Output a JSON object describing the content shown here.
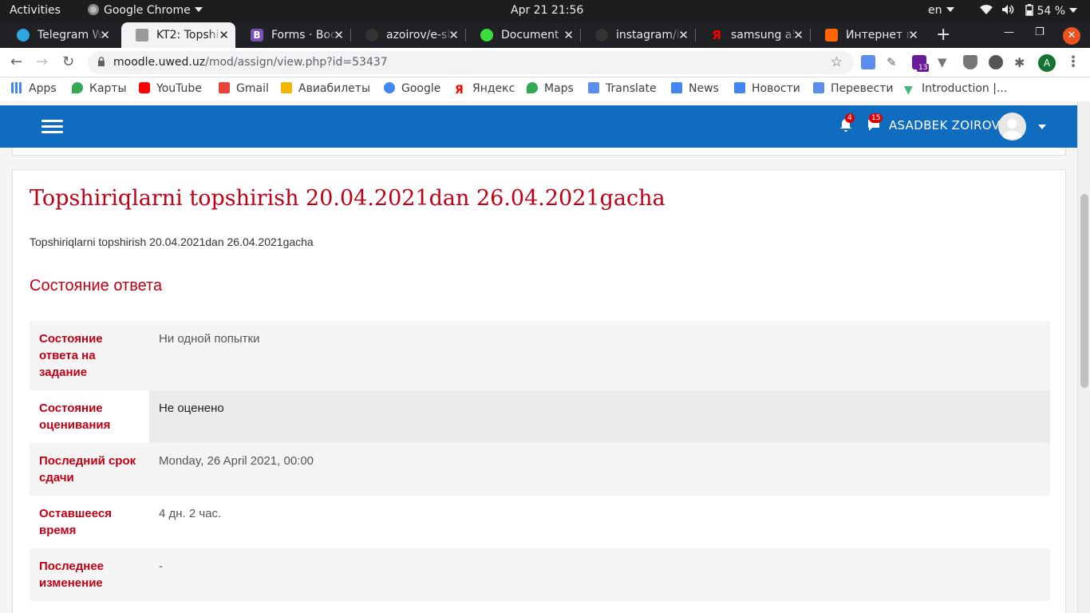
{
  "system": {
    "activities": "Activities",
    "app_name": "Google Chrome",
    "clock": "Apr 21  21:56",
    "lang": "en",
    "battery": "54 %"
  },
  "tabs": [
    {
      "label": "Telegram W",
      "active": false
    },
    {
      "label": "KT2: Topshi",
      "active": true
    },
    {
      "label": "Forms · Boo",
      "active": false
    },
    {
      "label": "azoirov/e-sl",
      "active": false
    },
    {
      "label": "Document",
      "active": false
    },
    {
      "label": "instagram/i",
      "active": false
    },
    {
      "label": "samsung a5",
      "active": false
    },
    {
      "label": "Интернет м",
      "active": false
    }
  ],
  "toolbar": {
    "url_host": "moodle.uwed.uz",
    "url_path": "/mod/assign/view.php?id=53437",
    "ext_badge": "13",
    "profile_initial": "A"
  },
  "bookmarks": [
    "Apps",
    "Карты",
    "YouTube",
    "Gmail",
    "Авиабилеты",
    "Google",
    "Яндекс",
    "Maps",
    "Translate",
    "News",
    "Новости",
    "Перевести",
    "Introduction |..."
  ],
  "moodle": {
    "notifications_count": "4",
    "messages_count": "15",
    "user_name": "ASADBEK ZOIROV",
    "title": "Topshiriqlarni topshirish 20.04.2021dan 26.04.2021gacha",
    "intro": "Topshiriqlarni topshirish 20.04.2021dan 26.04.2021gacha",
    "section_heading": "Состояние ответа",
    "rows": [
      {
        "label": "Состояние ответа на задание",
        "value": "Ни одной попытки"
      },
      {
        "label": "Состояние оценивания",
        "value": "Не оценено"
      },
      {
        "label": "Последний срок сдачи",
        "value": "Monday, 26 April 2021, 00:00"
      },
      {
        "label": "Оставшееся время",
        "value": "4 дн. 2 час."
      },
      {
        "label": "Последнее изменение",
        "value": "-"
      }
    ]
  },
  "colors": {
    "moodle_blue": "#0f6cbf",
    "heading_red": "#c00014"
  }
}
